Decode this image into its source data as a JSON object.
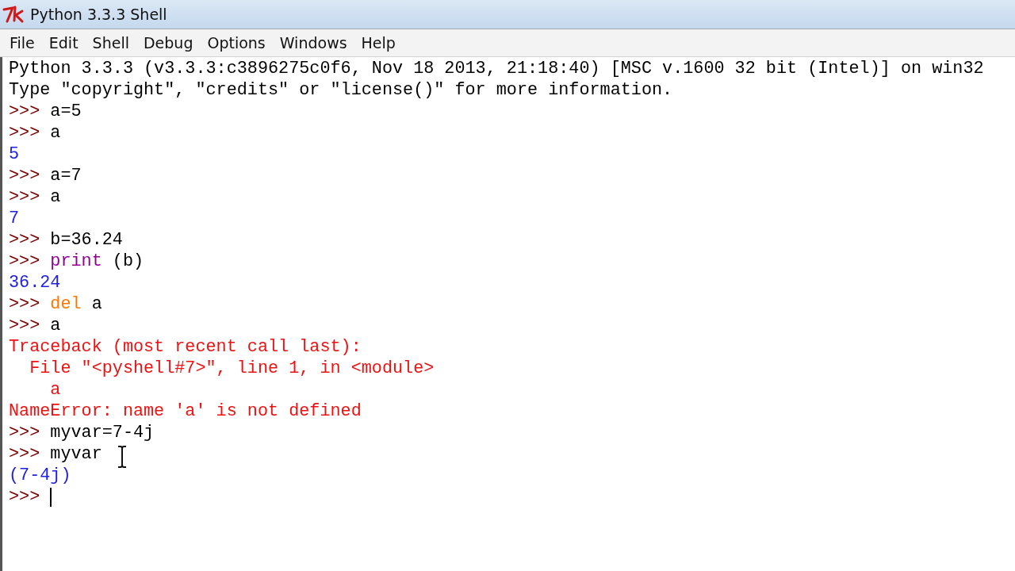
{
  "window": {
    "title": "Python 3.3.3 Shell"
  },
  "menu": [
    "File",
    "Edit",
    "Shell",
    "Debug",
    "Options",
    "Windows",
    "Help"
  ],
  "shell": {
    "lines": [
      [
        {
          "kind": "plain",
          "text": "Python 3.3.3 (v3.3.3:c3896275c0f6, Nov 18 2013, 21:18:40) [MSC v.1600 32 bit (Intel)] on win32"
        }
      ],
      [
        {
          "kind": "plain",
          "text": "Type \"copyright\", \"credits\" or \"license()\" for more information."
        }
      ],
      [
        {
          "kind": "prompt",
          "text": ">>>"
        },
        {
          "kind": "code",
          "text": "a=5"
        }
      ],
      [
        {
          "kind": "prompt",
          "text": ">>>"
        },
        {
          "kind": "code",
          "text": "a"
        }
      ],
      [
        {
          "kind": "stdout",
          "text": "5"
        }
      ],
      [
        {
          "kind": "prompt",
          "text": ">>>"
        },
        {
          "kind": "code",
          "text": "a=7"
        }
      ],
      [
        {
          "kind": "prompt",
          "text": ">>>"
        },
        {
          "kind": "code",
          "text": "a"
        }
      ],
      [
        {
          "kind": "stdout",
          "text": "7"
        }
      ],
      [
        {
          "kind": "prompt",
          "text": ">>>"
        },
        {
          "kind": "code",
          "text": "b=36.24"
        }
      ],
      [
        {
          "kind": "prompt",
          "text": ">>>"
        },
        {
          "kind": "builtin",
          "text": "print"
        },
        {
          "kind": "code",
          "text": "(b)"
        }
      ],
      [
        {
          "kind": "stdout",
          "text": "36.24"
        }
      ],
      [
        {
          "kind": "prompt",
          "text": ">>>"
        },
        {
          "kind": "keyword",
          "text": "del"
        },
        {
          "kind": "code",
          "text": "a"
        }
      ],
      [
        {
          "kind": "prompt",
          "text": ">>>"
        },
        {
          "kind": "code",
          "text": "a"
        }
      ],
      [
        {
          "kind": "stderr",
          "text": "Traceback (most recent call last):"
        }
      ],
      [
        {
          "kind": "stderr-indent1",
          "text": "File \"<pyshell#7>\", line 1, in <module>"
        }
      ],
      [
        {
          "kind": "stderr-indent2",
          "text": "a"
        }
      ],
      [
        {
          "kind": "stderr",
          "text": "NameError: name 'a' is not defined"
        }
      ],
      [
        {
          "kind": "prompt",
          "text": ">>>"
        },
        {
          "kind": "code",
          "text": "myvar=7-4j"
        }
      ],
      [
        {
          "kind": "prompt",
          "text": ">>>"
        },
        {
          "kind": "code",
          "text": "myvar"
        }
      ],
      [
        {
          "kind": "stdout",
          "text": "(7-4j)"
        }
      ],
      [
        {
          "kind": "prompt",
          "text": ">>>"
        }
      ]
    ]
  }
}
